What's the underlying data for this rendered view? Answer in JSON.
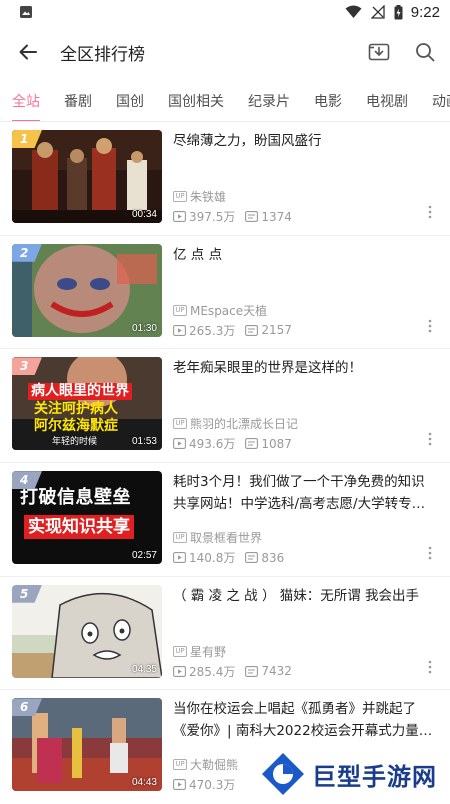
{
  "status_bar": {
    "time": "9:22"
  },
  "header": {
    "title": "全区排行榜"
  },
  "tabs": [
    {
      "label": "全站",
      "active": true
    },
    {
      "label": "番剧"
    },
    {
      "label": "国创"
    },
    {
      "label": "国创相关"
    },
    {
      "label": "纪录片"
    },
    {
      "label": "电影"
    },
    {
      "label": "电视剧"
    },
    {
      "label": "动画"
    }
  ],
  "colors": {
    "accent": "#fb7299",
    "rank1": "#f6c249",
    "rank2": "#7ca6e4",
    "rank3": "#f4a39b",
    "rank_other": "#9aa6c0"
  },
  "videos": [
    {
      "rank": "1",
      "title": "尽绵薄之力，盼国风盛行",
      "duration": "00:34",
      "up_name": "朱铁雄",
      "views": "397.5万",
      "danmaku": "1374"
    },
    {
      "rank": "2",
      "title": "亿 点 点",
      "duration": "01:30",
      "up_name": "MEspace天植",
      "views": "265.3万",
      "danmaku": "2157"
    },
    {
      "rank": "3",
      "title": "老年痴呆眼里的世界是这样的！",
      "duration": "01:53",
      "up_name": "熊羽的北漂成长日记",
      "views": "493.6万",
      "danmaku": "1087",
      "thumb_text": [
        "病人眼里的世界",
        "关注呵护病人",
        "阿尔兹海默症",
        "年轻的时候"
      ]
    },
    {
      "rank": "4",
      "title": "耗时3个月！我们做了一个干净免费的知识共享网站！中学选科/高考志愿/大学转专…",
      "duration": "02:57",
      "up_name": "取景框看世界",
      "views": "140.8万",
      "danmaku": "836",
      "thumb_text": [
        "打破信息壁垒",
        "实现知识共享"
      ]
    },
    {
      "rank": "5",
      "title": "（ 霸 凌 之 战 ） 猫妹：无所谓 我会出手",
      "duration": "04:35",
      "up_name": "星有野",
      "views": "285.4万",
      "danmaku": "7432"
    },
    {
      "rank": "6",
      "title": "当你在校运会上唱起《孤勇者》并跳起了《爱你》| 南科大2022校运会开幕式力量…",
      "duration": "04:43",
      "up_name": "大勒倔熊",
      "views": "470.3万",
      "danmaku": ""
    }
  ],
  "up_badge": "UP",
  "watermark": {
    "text": "巨型手游网"
  }
}
